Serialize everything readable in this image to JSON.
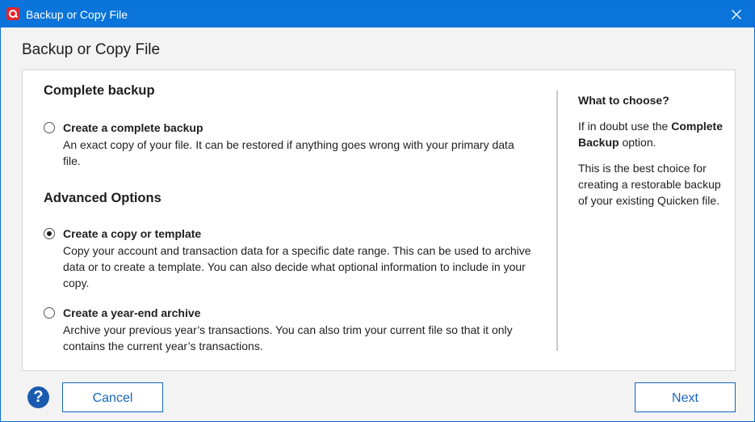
{
  "window": {
    "title": "Backup or Copy File"
  },
  "dialog": {
    "heading": "Backup or Copy File"
  },
  "complete_section": {
    "heading": "Complete backup",
    "option": {
      "label": "Create a complete backup",
      "description": "An exact copy of your file. It can be restored if anything goes wrong with your primary data file.",
      "selected": false
    }
  },
  "advanced_section": {
    "heading": "Advanced Options",
    "options": [
      {
        "label": "Create a copy or template",
        "description": "Copy your account and transaction data for a specific date range. This can be used to archive data or to create a template. You can also decide what optional information to include in your copy.",
        "selected": true
      },
      {
        "label": "Create a year-end archive",
        "description": "Archive your previous year’s transactions. You can also trim your current file so that it only contains the current year’s transactions.",
        "selected": false
      }
    ]
  },
  "sidebar": {
    "heading": "What to choose?",
    "paragraph1_prefix": "If in doubt use the",
    "paragraph1_bold": "Complete Backup",
    "paragraph1_suffix": "option.",
    "paragraph2": "This is the best choice for creating a restorable backup of your existing Quicken file."
  },
  "footer": {
    "help_symbol": "?",
    "cancel_label": "Cancel",
    "next_label": "Next"
  },
  "colors": {
    "titlebar": "#0a74da",
    "logo": "#e3262f",
    "button_accent": "#1565c0",
    "help_icon": "#1a5bb0"
  },
  "icons": {
    "app": "quicken-logo-icon",
    "close": "close-icon",
    "help": "help-icon"
  }
}
